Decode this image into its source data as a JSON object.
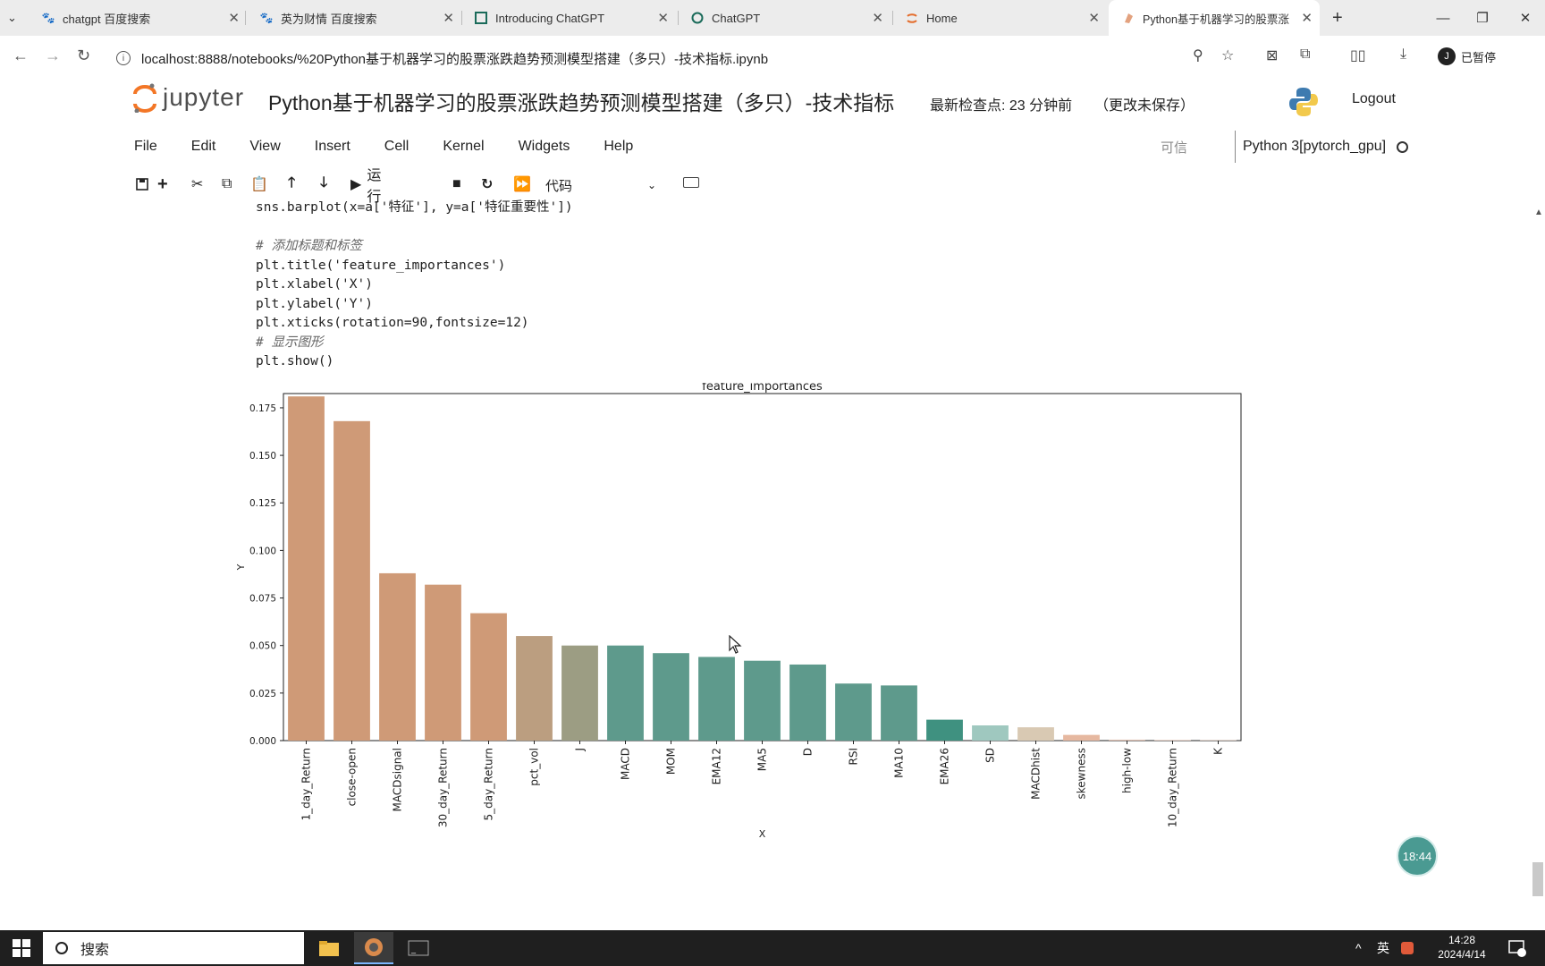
{
  "browser": {
    "tabs": [
      {
        "title": "chatgpt 百度搜索",
        "icon": "baidu-paw-icon"
      },
      {
        "title": "英为财情 百度搜索",
        "icon": "baidu-paw-icon"
      },
      {
        "title": "Introducing ChatGPT",
        "icon": "openai-icon"
      },
      {
        "title": "ChatGPT",
        "icon": "openai-icon"
      },
      {
        "title": "Home",
        "icon": "jupyter-icon"
      },
      {
        "title": "Python基于机器学习的股票涨",
        "icon": "notebook-icon"
      }
    ],
    "new_tab": "+",
    "url": "localhost:8888/notebooks/%20Python基于机器学习的股票涨跌趋势预测模型搭建（多只）-技术指标.ipynb",
    "profile_initial": "J",
    "profile_label": "已暂停"
  },
  "jupyter": {
    "logo_text": "jupyter",
    "notebook_title": "Python基于机器学习的股票涨跌趋势预测模型搭建（多只）-技术指标",
    "checkpoint": "最新检查点: 23 分钟前",
    "unsaved": "（更改未保存）",
    "logout": "Logout",
    "menu": [
      "File",
      "Edit",
      "View",
      "Insert",
      "Cell",
      "Kernel",
      "Widgets",
      "Help"
    ],
    "trusted": "可信",
    "kernel_name": "Python 3[pytorch_gpu]",
    "toolbar": {
      "run_label": "运行",
      "cell_type": "代码"
    }
  },
  "code_lines": [
    {
      "text": "sns.barplot(x=a['特征'], y=a['特征重要性'])",
      "kind": "code"
    },
    {
      "text": "",
      "kind": "code"
    },
    {
      "text": "# 添加标题和标签",
      "kind": "comment"
    },
    {
      "text": "plt.title('feature_importances')",
      "kind": "code"
    },
    {
      "text": "plt.xlabel('X')",
      "kind": "code"
    },
    {
      "text": "plt.ylabel('Y')",
      "kind": "code"
    },
    {
      "text": "plt.xticks(rotation=90,fontsize=12)",
      "kind": "code"
    },
    {
      "text": "# 显示图形",
      "kind": "comment"
    },
    {
      "text": "plt.show()",
      "kind": "code"
    }
  ],
  "chart_data": {
    "type": "bar",
    "title": "feature_importances",
    "xlabel": "X",
    "ylabel": "Y",
    "ylim": [
      0,
      0.1825
    ],
    "yticks": [
      "0.000",
      "0.025",
      "0.050",
      "0.075",
      "0.100",
      "0.125",
      "0.150",
      "0.175"
    ],
    "categories": [
      "1_day_Return",
      "close-open",
      "MACDsignal",
      "30_day_Return",
      "5_day_Return",
      "pct_vol",
      "J",
      "MACD",
      "MOM",
      "EMA12",
      "MA5",
      "D",
      "RSI",
      "MA10",
      "EMA26",
      "SD",
      "MACDhist",
      "skewness",
      "high-low",
      "10_day_Return",
      "K"
    ],
    "values": [
      0.181,
      0.168,
      0.088,
      0.082,
      0.067,
      0.055,
      0.05,
      0.05,
      0.046,
      0.044,
      0.042,
      0.04,
      0.03,
      0.029,
      0.011,
      0.008,
      0.007,
      0.003,
      0.0005,
      0.0003,
      0.0002
    ],
    "colors": [
      "#cf9a77",
      "#cf9a77",
      "#cf9a77",
      "#cf9a77",
      "#cf9a77",
      "#bb9e80",
      "#9c9d83",
      "#5e9a8c",
      "#5e9a8c",
      "#5e9a8c",
      "#5e9a8c",
      "#5e9a8c",
      "#5e9a8c",
      "#5e9a8c",
      "#3f9180",
      "#9fc8bf",
      "#d9c9b3",
      "#e6b8a0",
      "#e0c0b0",
      "#e0c0b0",
      "#e0c0b0"
    ],
    "grid": false,
    "legend": "none"
  },
  "timer_badge": "18:44",
  "taskbar": {
    "search_label": "搜索",
    "ime": "英",
    "time": "14:28",
    "date": "2024/4/14",
    "notification_count": "3"
  }
}
